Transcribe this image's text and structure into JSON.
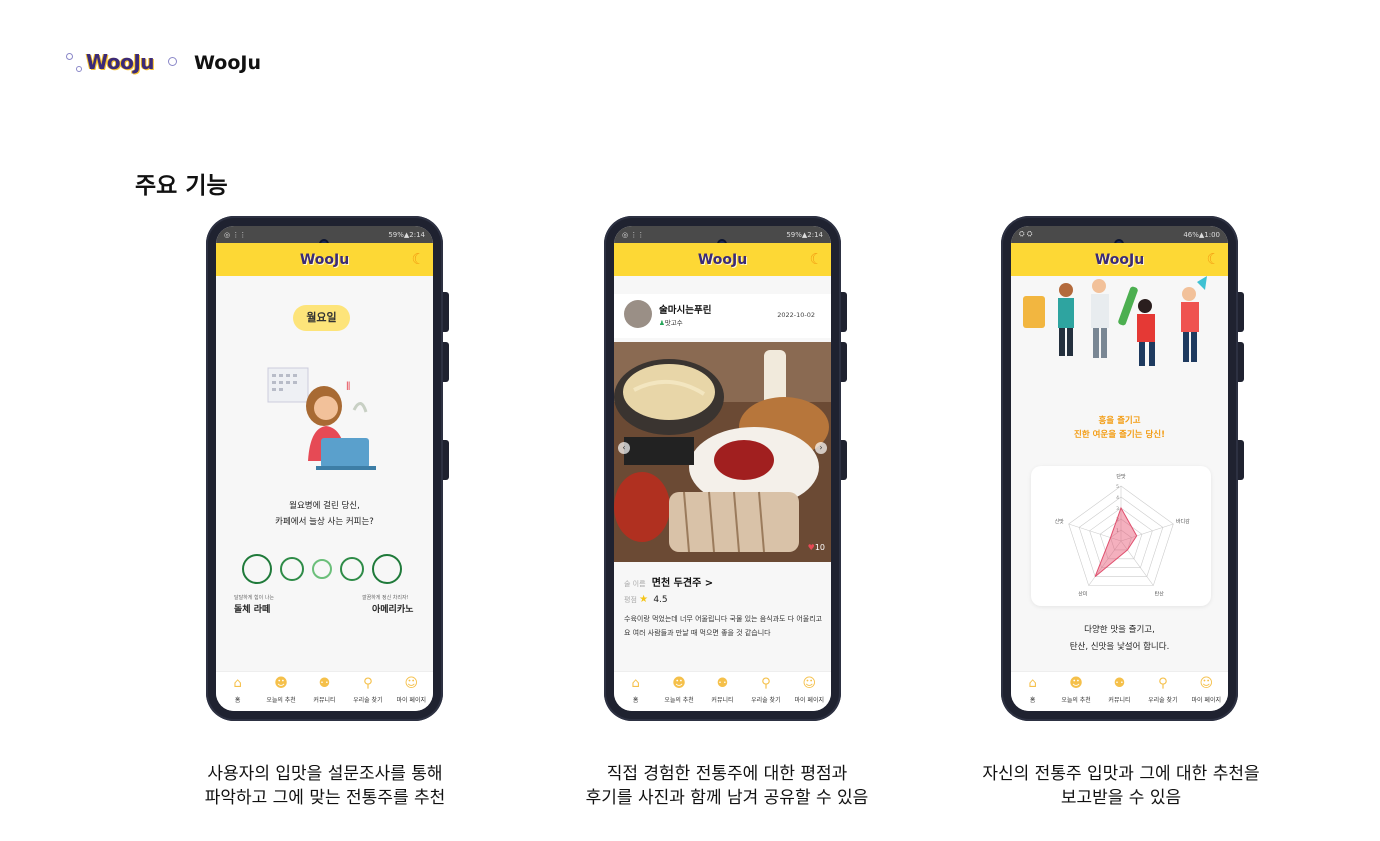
{
  "brand": {
    "logo_text": "WooJu",
    "title": "WooJu"
  },
  "section_title": "주요 기능",
  "colors": {
    "accent_yellow": "#fdd835",
    "pill": "#fde47a",
    "logo_purple": "#3b2a78",
    "orange": "#f39c12",
    "green": "#1f7a3a"
  },
  "tabs": [
    {
      "icon": "home-icon",
      "label": "홈"
    },
    {
      "icon": "person-recommend-icon",
      "label": "오늘의 추천"
    },
    {
      "icon": "community-icon",
      "label": "커뮤니티"
    },
    {
      "icon": "bottle-search-icon",
      "label": "우리술 찾기"
    },
    {
      "icon": "my-page-icon",
      "label": "마이 페이지"
    }
  ],
  "phone1": {
    "status_right": "59%▲2:14",
    "day_pill": "월요일",
    "question_line1": "월요병에 걸린 당신,",
    "question_line2": "카페에서 늘상 사는 커피는?",
    "left_small": "달달하게 힘이 나는",
    "left_big": "돌체 라떼",
    "right_small": "깔끔하게 정신 차리자!",
    "right_big": "아메리카노"
  },
  "phone2": {
    "status_right": "59%▲2:14",
    "username": "술마시는푸린",
    "badge": "맛고수",
    "date": "2022-10-02",
    "likes": "10",
    "sool_label": "술 이름",
    "sool_name": "면천 두견주 >",
    "rating_label": "평점",
    "rating_value": "4.5",
    "review": "수육이랑 먹었는데 너무 어울립니다 국물 있는 음식과도 다 어울리고요 여러 사람들과 만날 때 먹으면 좋을 것 같습니다"
  },
  "phone3": {
    "status_right": "46%▲1:00",
    "title_line1": "흥을 즐기고",
    "title_line2": "진한 여운을 즐기는 당신!",
    "radar_labels": [
      "단맛",
      "바디감",
      "탄산",
      "산미",
      "신맛"
    ],
    "radar_ticks": [
      "5",
      "4",
      "3",
      "2",
      "1"
    ],
    "radar_values": [
      3,
      1.5,
      1,
      4,
      1
    ],
    "desc_line1": "다양한 맛을 즐기고,",
    "desc_line2": "탄산, 신맛을 낯설어 합니다."
  },
  "captions": [
    {
      "line1": "사용자의 입맛을 설문조사를 통해",
      "line2": "파악하고 그에 맞는 전통주를 추천"
    },
    {
      "line1": "직접 경험한 전통주에 대한 평점과",
      "line2": "후기를 사진과 함께 남겨 공유할 수 있음"
    },
    {
      "line1": "자신의 전통주 입맛과 그에 대한 추천을",
      "line2": "보고받을 수 있음"
    }
  ]
}
